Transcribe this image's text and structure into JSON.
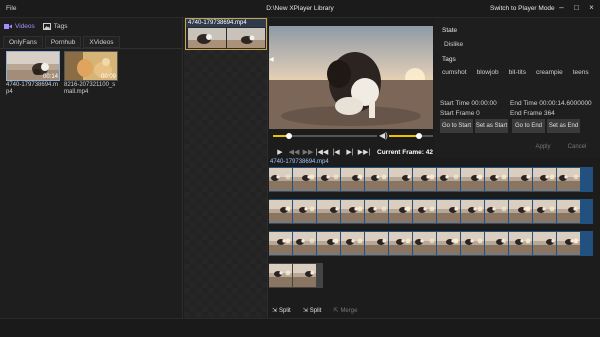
{
  "titlebar": {
    "file_menu": "File",
    "title": "D:\\New XPlayer Library",
    "mode_button": "Switch to Player Mode"
  },
  "library": {
    "top_tabs": [
      {
        "label": "Videos",
        "icon": "video-icon"
      },
      {
        "label": "Tags",
        "icon": "image-icon"
      }
    ],
    "sub_tabs": [
      "OnlyFans",
      "Pornhub",
      "XVideos"
    ],
    "videos": [
      {
        "duration": "00:14",
        "name": "4740-179738694.mp4"
      },
      {
        "duration": "00:09",
        "name": "8216-207321100_small.mp4"
      }
    ]
  },
  "clip": {
    "name": "4740-179738694.mp4"
  },
  "player": {
    "current_frame_label": "Current Frame: 42",
    "seek_progress": 0.15,
    "volume_level": 0.68
  },
  "props": {
    "state_label": "State",
    "state_value": "Dislike",
    "tags_label": "Tags",
    "tags": [
      "cumshot",
      "blowjob",
      "bit-tits",
      "creampie",
      "teens"
    ],
    "start_time": "Start Time 00:00:00",
    "end_time": "End Time 00:00:14.6000000",
    "start_frame": "Start Frame 0",
    "end_frame": "End Frame 364",
    "go_to_start": "Go to Start",
    "set_as_start": "Set as Start",
    "go_to_end": "Go to End",
    "set_as_end": "Set as End",
    "apply": "Apply",
    "cancel": "Cancel"
  },
  "timeline": {
    "name": "4740-179738694.mp4"
  },
  "bottom": {
    "split1": "Split",
    "split2": "Split",
    "merge": "Merge"
  }
}
